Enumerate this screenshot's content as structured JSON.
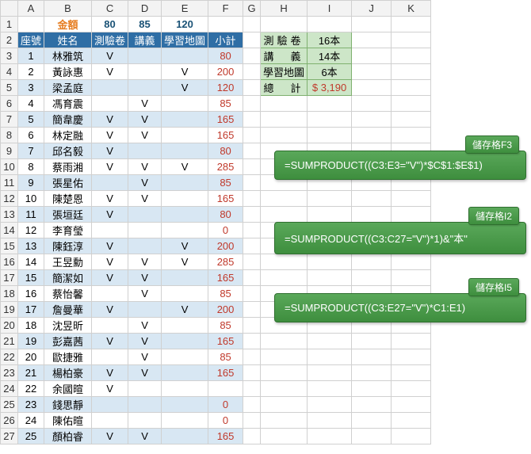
{
  "col_headers": [
    "",
    "A",
    "B",
    "C",
    "D",
    "E",
    "F",
    "G",
    "H",
    "I",
    "J",
    "K"
  ],
  "row_header_labels": [
    "1",
    "2",
    "3",
    "4",
    "5",
    "6",
    "7",
    "8",
    "9",
    "10",
    "11",
    "12",
    "13",
    "14",
    "15",
    "16",
    "17",
    "18",
    "19",
    "20",
    "21",
    "22",
    "23",
    "24",
    "25",
    "26",
    "27"
  ],
  "header_row1": {
    "amount_label": "金額",
    "c": "80",
    "d": "85",
    "e": "120"
  },
  "header_row2": {
    "seat": "座號",
    "name": "姓名",
    "c": "測驗卷",
    "d": "講義",
    "e": "學習地圖",
    "f": "小計"
  },
  "rows": [
    {
      "seat": "1",
      "name": "林雅筑",
      "c": "V",
      "d": "",
      "e": "",
      "sub": "80"
    },
    {
      "seat": "2",
      "name": "黃詠惠",
      "c": "V",
      "d": "",
      "e": "V",
      "sub": "200"
    },
    {
      "seat": "3",
      "name": "梁孟庭",
      "c": "",
      "d": "",
      "e": "V",
      "sub": "120"
    },
    {
      "seat": "4",
      "name": "馮育震",
      "c": "",
      "d": "V",
      "e": "",
      "sub": "85"
    },
    {
      "seat": "5",
      "name": "簡韋慶",
      "c": "V",
      "d": "V",
      "e": "",
      "sub": "165"
    },
    {
      "seat": "6",
      "name": "林定融",
      "c": "V",
      "d": "V",
      "e": "",
      "sub": "165"
    },
    {
      "seat": "7",
      "name": "邱名毅",
      "c": "V",
      "d": "",
      "e": "",
      "sub": "80"
    },
    {
      "seat": "8",
      "name": "蔡雨湘",
      "c": "V",
      "d": "V",
      "e": "V",
      "sub": "285"
    },
    {
      "seat": "9",
      "name": "張星佑",
      "c": "",
      "d": "V",
      "e": "",
      "sub": "85"
    },
    {
      "seat": "10",
      "name": "陳楚恩",
      "c": "V",
      "d": "V",
      "e": "",
      "sub": "165"
    },
    {
      "seat": "11",
      "name": "張垣廷",
      "c": "V",
      "d": "",
      "e": "",
      "sub": "80"
    },
    {
      "seat": "12",
      "name": "李育瑩",
      "c": "",
      "d": "",
      "e": "",
      "sub": "0"
    },
    {
      "seat": "13",
      "name": "陳鈺淳",
      "c": "V",
      "d": "",
      "e": "V",
      "sub": "200"
    },
    {
      "seat": "14",
      "name": "王昱勳",
      "c": "V",
      "d": "V",
      "e": "V",
      "sub": "285"
    },
    {
      "seat": "15",
      "name": "簡潔如",
      "c": "V",
      "d": "V",
      "e": "",
      "sub": "165"
    },
    {
      "seat": "16",
      "name": "蔡怡馨",
      "c": "",
      "d": "V",
      "e": "",
      "sub": "85"
    },
    {
      "seat": "17",
      "name": "詹曼華",
      "c": "V",
      "d": "",
      "e": "V",
      "sub": "200"
    },
    {
      "seat": "18",
      "name": "沈昱昕",
      "c": "",
      "d": "V",
      "e": "",
      "sub": "85"
    },
    {
      "seat": "19",
      "name": "彭嘉茜",
      "c": "V",
      "d": "V",
      "e": "",
      "sub": "165"
    },
    {
      "seat": "20",
      "name": "歐捷雅",
      "c": "",
      "d": "V",
      "e": "",
      "sub": "85"
    },
    {
      "seat": "21",
      "name": "楊柏豪",
      "c": "V",
      "d": "V",
      "e": "",
      "sub": "165"
    },
    {
      "seat": "22",
      "name": "余國暄",
      "c": "V",
      "d": "",
      "e": "",
      "sub": ""
    },
    {
      "seat": "23",
      "name": "錢思靜",
      "c": "",
      "d": "",
      "e": "",
      "sub": "0"
    },
    {
      "seat": "24",
      "name": "陳佑暄",
      "c": "",
      "d": "",
      "e": "",
      "sub": "0"
    },
    {
      "seat": "25",
      "name": "顏柏睿",
      "c": "V",
      "d": "V",
      "e": "",
      "sub": "165"
    }
  ],
  "summary": {
    "r1": {
      "label": "測驗卷",
      "val": "16本"
    },
    "r2": {
      "label": "講　義",
      "val": "14本"
    },
    "r3": {
      "label": "學習地圖",
      "val": "6本"
    },
    "r4": {
      "label": "總　計",
      "val": "$ 3,190"
    }
  },
  "callouts": {
    "c1": {
      "tag": "儲存格F3",
      "formula": "=SUMPRODUCT((C3:E3=\"V\")*$C$1:$E$1)"
    },
    "c2": {
      "tag": "儲存格I2",
      "formula": "=SUMPRODUCT((C3:C27=\"V\")*1)&\"本\""
    },
    "c3": {
      "tag": "儲存格I5",
      "formula": "=SUMPRODUCT((C3:E27=\"V\")*C1:E1)"
    }
  },
  "chart_data": {
    "type": "table",
    "title": "金額 測驗卷80 講義85 學習地圖120",
    "columns": [
      "座號",
      "姓名",
      "測驗卷",
      "講義",
      "學習地圖",
      "小計"
    ],
    "prices": {
      "測驗卷": 80,
      "講義": 85,
      "學習地圖": 120
    },
    "records": [
      [
        1,
        "林雅筑",
        "V",
        "",
        "",
        80
      ],
      [
        2,
        "黃詠惠",
        "V",
        "",
        "V",
        200
      ],
      [
        3,
        "梁孟庭",
        "",
        "",
        "V",
        120
      ],
      [
        4,
        "馮育震",
        "",
        "V",
        "",
        85
      ],
      [
        5,
        "簡韋慶",
        "V",
        "V",
        "",
        165
      ],
      [
        6,
        "林定融",
        "V",
        "V",
        "",
        165
      ],
      [
        7,
        "邱名毅",
        "V",
        "",
        "",
        80
      ],
      [
        8,
        "蔡雨湘",
        "V",
        "V",
        "V",
        285
      ],
      [
        9,
        "張星佑",
        "",
        "V",
        "",
        85
      ],
      [
        10,
        "陳楚恩",
        "V",
        "V",
        "",
        165
      ],
      [
        11,
        "張垣廷",
        "V",
        "",
        "",
        80
      ],
      [
        12,
        "李育瑩",
        "",
        "",
        "",
        0
      ],
      [
        13,
        "陳鈺淳",
        "V",
        "",
        "V",
        200
      ],
      [
        14,
        "王昱勳",
        "V",
        "V",
        "V",
        285
      ],
      [
        15,
        "簡潔如",
        "V",
        "V",
        "",
        165
      ],
      [
        16,
        "蔡怡馨",
        "",
        "V",
        "",
        85
      ],
      [
        17,
        "詹曼華",
        "V",
        "",
        "V",
        200
      ],
      [
        18,
        "沈昱昕",
        "",
        "V",
        "",
        85
      ],
      [
        19,
        "彭嘉茜",
        "V",
        "V",
        "",
        165
      ],
      [
        20,
        "歐捷雅",
        "",
        "V",
        "",
        85
      ],
      [
        21,
        "楊柏豪",
        "V",
        "V",
        "",
        165
      ],
      [
        22,
        "余國暄",
        "V",
        "",
        "",
        null
      ],
      [
        23,
        "錢思靜",
        "",
        "",
        "",
        0
      ],
      [
        24,
        "陳佑暄",
        "",
        "",
        "",
        0
      ],
      [
        25,
        "顏柏睿",
        "V",
        "V",
        "",
        165
      ]
    ],
    "summary": {
      "測驗卷": "16本",
      "講義": "14本",
      "學習地圖": "6本",
      "總計": 3190
    }
  }
}
